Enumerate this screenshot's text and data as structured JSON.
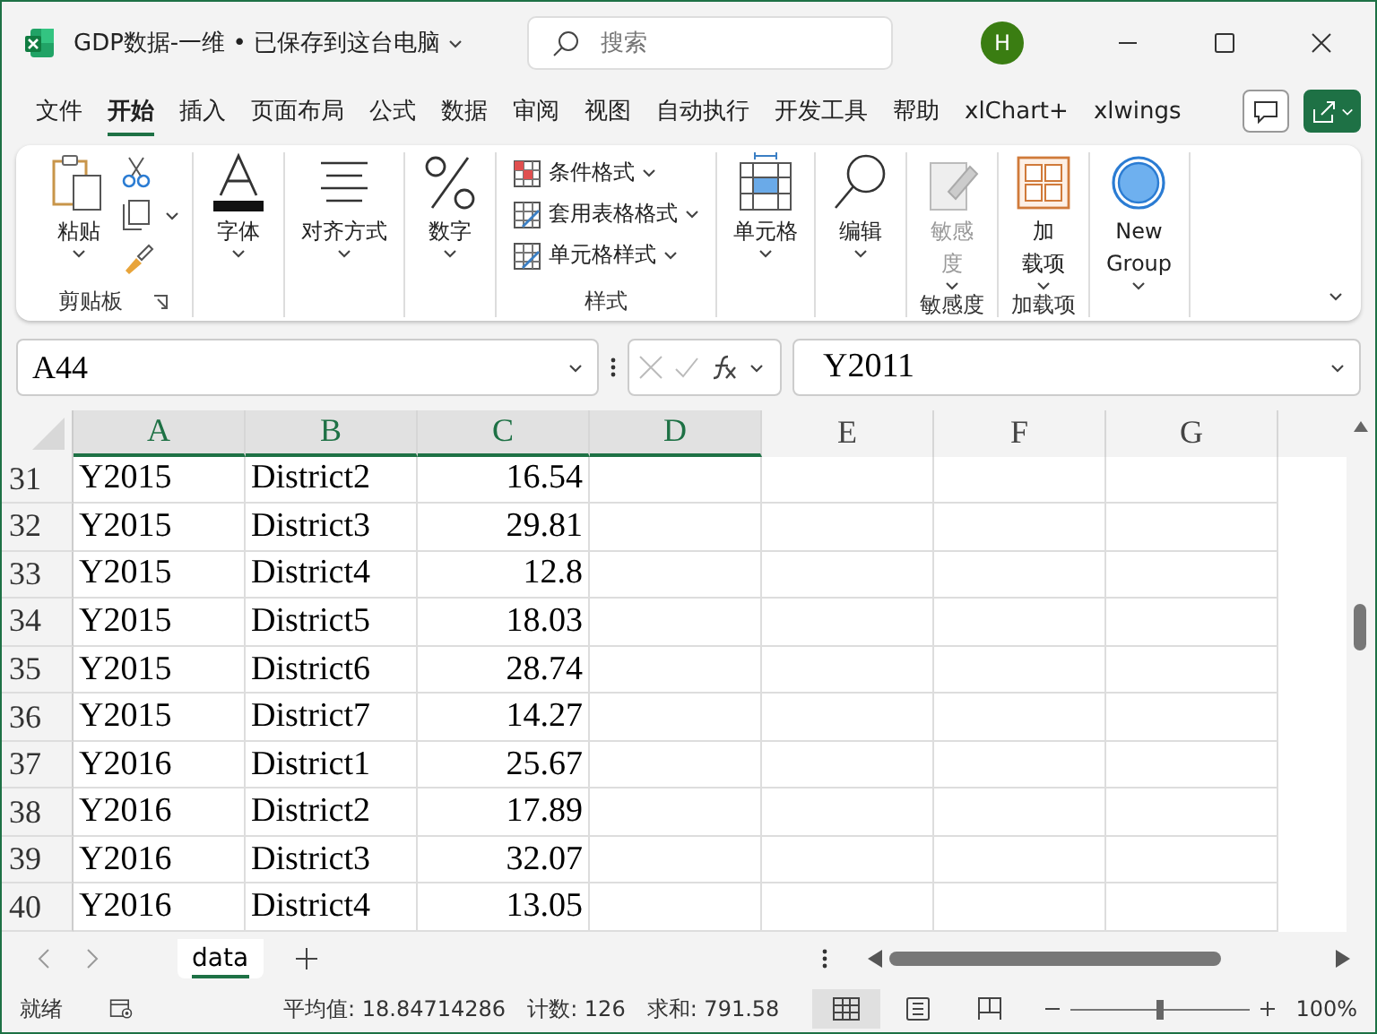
{
  "window": {
    "title": "GDP数据-一维 • 已保存到这台电脑",
    "search_placeholder": "搜索",
    "avatar": "H"
  },
  "menu_tabs": [
    {
      "label": "文件",
      "selected": false
    },
    {
      "label": "开始",
      "selected": true
    },
    {
      "label": "插入",
      "selected": false
    },
    {
      "label": "页面布局",
      "selected": false
    },
    {
      "label": "公式",
      "selected": false
    },
    {
      "label": "数据",
      "selected": false
    },
    {
      "label": "审阅",
      "selected": false
    },
    {
      "label": "视图",
      "selected": false
    },
    {
      "label": "自动执行",
      "selected": false
    },
    {
      "label": "开发工具",
      "selected": false
    },
    {
      "label": "帮助",
      "selected": false
    },
    {
      "label": "xlChart+",
      "selected": false
    },
    {
      "label": "xlwings",
      "selected": false
    }
  ],
  "ribbon": [
    {
      "label": "剪贴板",
      "launcher": true,
      "items": [
        {
          "kind": "paste",
          "text": "粘贴",
          "disabled": false
        }
      ]
    },
    {
      "items": [
        {
          "kind": "font",
          "text": "字体",
          "disabled": false
        }
      ]
    },
    {
      "items": [
        {
          "kind": "align",
          "text": "对齐方式",
          "disabled": false
        }
      ]
    },
    {
      "items": [
        {
          "kind": "number",
          "text": "数字",
          "disabled": false
        }
      ]
    },
    {
      "label": "样式",
      "items": [
        {
          "kind": "styles",
          "rows": [
            "条件格式",
            "套用表格格式",
            "单元格样式"
          ]
        }
      ]
    },
    {
      "items": [
        {
          "kind": "cells",
          "text": "单元格",
          "disabled": false
        }
      ]
    },
    {
      "items": [
        {
          "kind": "edit",
          "text": "编辑",
          "disabled": false
        }
      ]
    },
    {
      "label": "敏感度",
      "items": [
        {
          "kind": "sensitivity",
          "lines": [
            "敏感",
            "度"
          ],
          "disabled": true
        }
      ]
    },
    {
      "label": "加载项",
      "items": [
        {
          "kind": "addins",
          "lines": [
            "加",
            "载项"
          ],
          "disabled": false
        }
      ]
    },
    {
      "items": [
        {
          "kind": "newgroup",
          "lines": [
            "New",
            "Group"
          ],
          "disabled": false
        }
      ]
    }
  ],
  "formula_bar": {
    "name_box": "A44",
    "formula": "Y2011"
  },
  "columns": [
    {
      "label": "A",
      "selected": true
    },
    {
      "label": "B",
      "selected": true
    },
    {
      "label": "C",
      "selected": true
    },
    {
      "label": "D",
      "selected": true
    },
    {
      "label": "E",
      "selected": false
    },
    {
      "label": "F",
      "selected": false
    },
    {
      "label": "G",
      "selected": false
    }
  ],
  "rows": [
    {
      "number": "31",
      "cells": [
        "Y2015",
        "District2",
        "16.54"
      ]
    },
    {
      "number": "32",
      "cells": [
        "Y2015",
        "District3",
        "29.81"
      ]
    },
    {
      "number": "33",
      "cells": [
        "Y2015",
        "District4",
        "12.8"
      ]
    },
    {
      "number": "34",
      "cells": [
        "Y2015",
        "District5",
        "18.03"
      ]
    },
    {
      "number": "35",
      "cells": [
        "Y2015",
        "District6",
        "28.74"
      ]
    },
    {
      "number": "36",
      "cells": [
        "Y2015",
        "District7",
        "14.27"
      ]
    },
    {
      "number": "37",
      "cells": [
        "Y2016",
        "District1",
        "25.67"
      ]
    },
    {
      "number": "38",
      "cells": [
        "Y2016",
        "District2",
        "17.89"
      ]
    },
    {
      "number": "39",
      "cells": [
        "Y2016",
        "District3",
        "32.07"
      ]
    },
    {
      "number": "40",
      "cells": [
        "Y2016",
        "District4",
        "13.05"
      ]
    }
  ],
  "sheet_tabs": [
    {
      "label": "data",
      "selected": true
    }
  ],
  "status_bar": {
    "ready": "就绪",
    "average": "平均值: 18.84714286",
    "count": "计数: 126",
    "sum": "求和: 791.58",
    "views": [
      {
        "kind": "normal",
        "selected": true
      },
      {
        "kind": "page_layout",
        "selected": false
      },
      {
        "kind": "page_break",
        "selected": false
      }
    ],
    "zoom": {
      "level": 0.5,
      "reading": "100%"
    }
  }
}
